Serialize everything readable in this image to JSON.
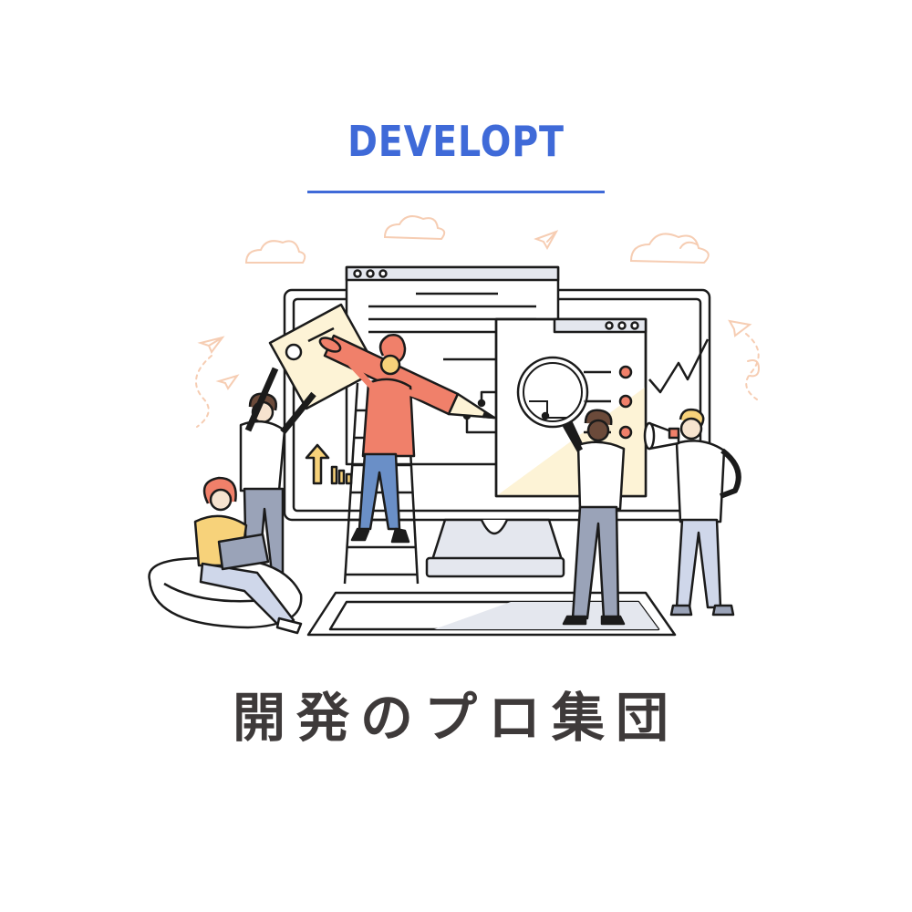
{
  "brand": {
    "name": "DEVELOPT",
    "accent_color": "#3f6ad8"
  },
  "tagline": "開発のプロ集団",
  "illustration": {
    "subject": "development-team-illustration",
    "accent_colors": {
      "salmon": "#f0806a",
      "mustard": "#f7d27a",
      "cream": "#fdf3d6",
      "light_gray": "#e4e7ee",
      "ink": "#1b1b1b",
      "peach_doodle": "#f6cdb3"
    }
  }
}
